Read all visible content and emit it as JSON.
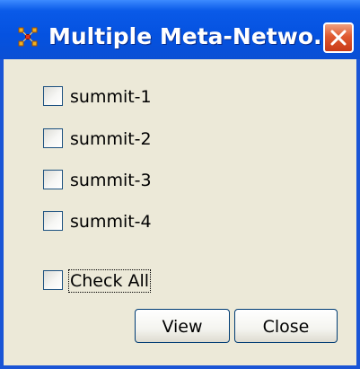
{
  "window": {
    "title": "Multiple Meta-Netwo...",
    "close_icon": "close-icon",
    "app_icon": "ora-network-icon"
  },
  "checkboxes": [
    {
      "label": "summit-1",
      "checked": false
    },
    {
      "label": "summit-2",
      "checked": false
    },
    {
      "label": "summit-3",
      "checked": false
    },
    {
      "label": "summit-4",
      "checked": false
    }
  ],
  "check_all": {
    "label": "Check All",
    "checked": false
  },
  "buttons": {
    "view_label": "View",
    "close_label": "Close"
  },
  "colors": {
    "titlebar": "#0552e0",
    "dialog_bg": "#ece9d8",
    "close_button": "#e05a30",
    "app_icon": "#e8a020"
  }
}
